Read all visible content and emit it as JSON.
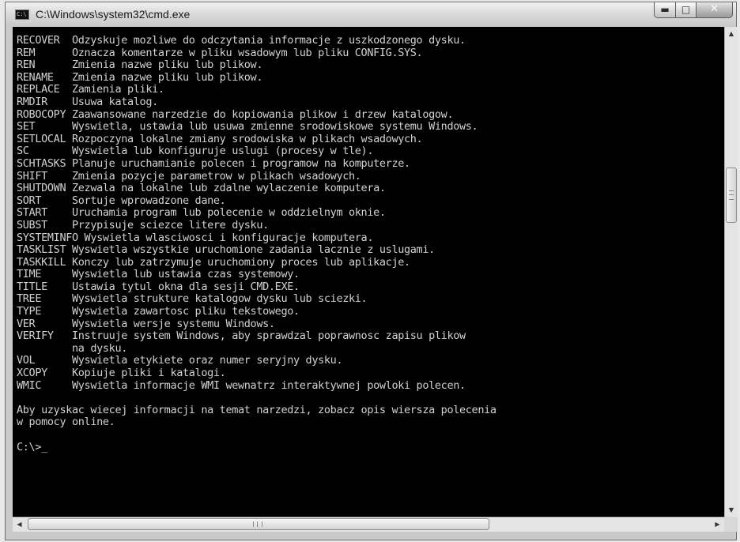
{
  "window": {
    "title": "C:\\Windows\\system32\\cmd.exe",
    "icon": "cmd-icon",
    "controls": {
      "minimize_icon": "minimize-icon",
      "maximize_icon": "maximize-icon",
      "close_icon": "close-icon"
    }
  },
  "console": {
    "lines": [
      "RECOVER  Odzyskuje mozliwe do odczytania informacje z uszkodzonego dysku.",
      "REM      Oznacza komentarze w pliku wsadowym lub pliku CONFIG.SYS.",
      "REN      Zmienia nazwe pliku lub plikow.",
      "RENAME   Zmienia nazwe pliku lub plikow.",
      "REPLACE  Zamienia pliki.",
      "RMDIR    Usuwa katalog.",
      "ROBOCOPY Zaawansowane narzedzie do kopiowania plikow i drzew katalogow.",
      "SET      Wyswietla, ustawia lub usuwa zmienne srodowiskowe systemu Windows.",
      "SETLOCAL Rozpoczyna lokalne zmiany srodowiska w plikach wsadowych.",
      "SC       Wyswietla lub konfiguruje uslugi (procesy w tle).",
      "SCHTASKS Planuje uruchamianie polecen i programow na komputerze.",
      "SHIFT    Zmienia pozycje parametrow w plikach wsadowych.",
      "SHUTDOWN Zezwala na lokalne lub zdalne wylaczenie komputera.",
      "SORT     Sortuje wprowadzone dane.",
      "START    Uruchamia program lub polecenie w oddzielnym oknie.",
      "SUBST    Przypisuje sciezce litere dysku.",
      "SYSTEMINFO Wyswietla wlasciwosci i konfiguracje komputera.",
      "TASKLIST Wyswietla wszystkie uruchomione zadania lacznie z uslugami.",
      "TASKKILL Konczy lub zatrzymuje uruchomiony proces lub aplikacje.",
      "TIME     Wyswietla lub ustawia czas systemowy.",
      "TITLE    Ustawia tytul okna dla sesji CMD.EXE.",
      "TREE     Wyswietla strukture katalogow dysku lub sciezki.",
      "TYPE     Wyswietla zawartosc pliku tekstowego.",
      "VER      Wyswietla wersje systemu Windows.",
      "VERIFY   Instruuje system Windows, aby sprawdzal poprawnosc zapisu plikow",
      "         na dysku.",
      "VOL      Wyswietla etykiete oraz numer seryjny dysku.",
      "XCOPY    Kopiuje pliki i katalogi.",
      "WMIC     Wyswietla informacje WMI wewnatrz interaktywnej powloki polecen.",
      "",
      "Aby uzyskac wiecej informacji na temat narzedzi, zobacz opis wiersza polecenia",
      "w pomocy online.",
      "",
      "C:\\>"
    ],
    "cursor": "_"
  },
  "scrollbars": {
    "vertical": {
      "up_icon": "scroll-up-arrow-icon",
      "down_icon": "scroll-down-arrow-icon"
    },
    "horizontal": {
      "left_icon": "scroll-left-arrow-icon",
      "right_icon": "scroll-right-arrow-icon"
    }
  },
  "colors": {
    "console_background": "#000000",
    "console_text": "#d2d2d2"
  }
}
